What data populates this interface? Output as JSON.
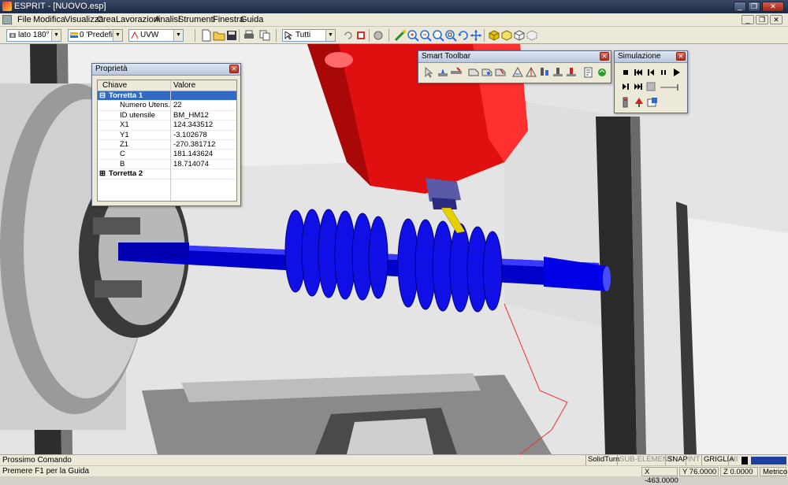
{
  "window": {
    "title": "ESPRIT - [NUOVO.esp]",
    "controls": {
      "minimize": "_",
      "restore": "❐",
      "close": "✕"
    },
    "inner_controls": {
      "minimize": "_",
      "restore": "❐",
      "close": "✕"
    }
  },
  "menu": {
    "items": [
      "File",
      "Modifica",
      "Visualizza",
      "Crea",
      "Lavorazioni",
      "Analisi",
      "Strumenti",
      "Finestra",
      "Guida"
    ]
  },
  "toolbar": {
    "view_combo": "lato 180° *",
    "layer_combo": "0 'Predefin",
    "uvw_combo": "UVW",
    "filter_combo": "Tutti",
    "icons": [
      "view-icon",
      "layer-icon",
      "uvw-icon",
      "new-file-icon",
      "open-folder-icon",
      "save-icon",
      "print-icon",
      "copy-icon",
      "select-pointer-icon",
      "undo-icon",
      "delete-icon",
      "target-icon",
      "pan-icon",
      "zoom-in-icon",
      "zoom-out-icon",
      "zoom-window-icon",
      "zoom-fit-icon",
      "rotate-icon",
      "move-icon",
      "shaded-icon",
      "wire-icon",
      "hidden-icon",
      "transparent-icon"
    ]
  },
  "properties_panel": {
    "title": "Proprietà",
    "close": "✕",
    "columns": {
      "key": "Chiave",
      "value": "Valore"
    },
    "groups": [
      {
        "name": "Torretta 1",
        "expander": "⊟",
        "rows": [
          {
            "key": "Numero Utens...",
            "value": "22"
          },
          {
            "key": "ID utensile",
            "value": "BM_HM12"
          },
          {
            "key": "X1",
            "value": "124.343512"
          },
          {
            "key": "Y1",
            "value": "-3.102678"
          },
          {
            "key": "Z1",
            "value": "-270.381712"
          },
          {
            "key": "C",
            "value": "181.143624"
          },
          {
            "key": "B",
            "value": "18.714074"
          }
        ]
      },
      {
        "name": "Torretta 2",
        "expander": "⊞",
        "rows": []
      }
    ]
  },
  "smart_toolbar": {
    "title": "Smart Toolbar",
    "close": "✕",
    "icons": [
      "cursor-icon",
      "tool-icon",
      "turning-icon",
      "contour-icon",
      "drill-icon",
      "pocket-icon",
      "thread-icon",
      "profile-icon",
      "mill-icon",
      "slot-icon",
      "face-icon",
      "groove-icon",
      "report-icon",
      "recycle-icon"
    ]
  },
  "simulation_panel": {
    "title": "Simulazione",
    "close": "✕",
    "controls": [
      "stop-icon",
      "rewind-icon",
      "step-back-icon",
      "pause-icon",
      "play-icon",
      "step-forward-icon",
      "fast-forward-icon",
      "end-icon",
      "speed-slider-icon",
      "clear-icon",
      "tool-path-icon",
      "stock-icon",
      "report-icon"
    ]
  },
  "command_bar": {
    "label": "Prossimo Comando",
    "modes": [
      {
        "label": "SolidTurn",
        "active": true
      },
      {
        "label": "SUB-ELEMENTI",
        "active": false
      },
      {
        "label": "SNAP",
        "active": true
      },
      {
        "label": "INT",
        "active": false
      },
      {
        "label": "GRIGLIA",
        "active": true
      },
      {
        "label": "HI",
        "active": false
      }
    ],
    "colors": {
      "accent": "#1f3f9f",
      "selection": "#316ac5"
    }
  },
  "status_bar": {
    "hint": "Premere F1 per la Guida",
    "x": "X -463.0000",
    "y": "Y 76.0000",
    "z": "Z 0.0000",
    "units": "Metrico"
  },
  "scene_colors": {
    "workpiece": "#0000e6",
    "spindle_head": "#e01010",
    "tool_tip": "#e6d000",
    "background": "#e6e6e6"
  }
}
